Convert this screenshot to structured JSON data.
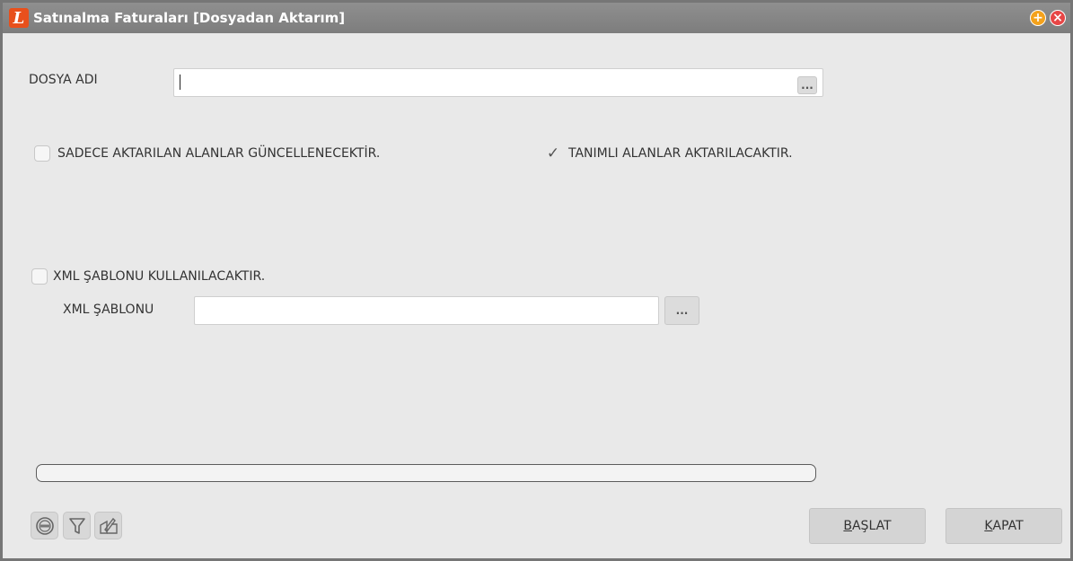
{
  "window": {
    "title": "Satınalma Faturaları [Dosyadan Aktarım]",
    "logo_letter": "L",
    "maximize_glyph": "+",
    "close_glyph": "×"
  },
  "file_name": {
    "label": "DOSYA ADI",
    "value": "",
    "browse_label": "..."
  },
  "options": {
    "update_only_transferred": {
      "label": "SADECE AKTARILAN ALANLAR GÜNCELLENECEKTİR.",
      "checked": false
    },
    "transfer_defined": {
      "label": "TANIMLI ALANLAR AKTARILACAKTIR.",
      "checked": true,
      "check_glyph": "✓"
    },
    "use_xml_template": {
      "label": "XML ŞABLONU KULLANILACAKTIR.",
      "checked": false
    }
  },
  "xml_template": {
    "label": "XML ŞABLONU",
    "value": "",
    "browse_label": "..."
  },
  "progress": {
    "value": 0
  },
  "toolbar": {
    "icons": [
      "xml-icon",
      "filter-icon",
      "edit-icon"
    ]
  },
  "actions": {
    "start_first": "B",
    "start_rest": "AŞLAT",
    "close_first": "K",
    "close_rest": "APAT"
  },
  "colors": {
    "titlebar": "#858585",
    "logo": "#e8501c",
    "maximize": "#f4a21c",
    "close": "#e74646",
    "background": "#e9e9e9"
  }
}
